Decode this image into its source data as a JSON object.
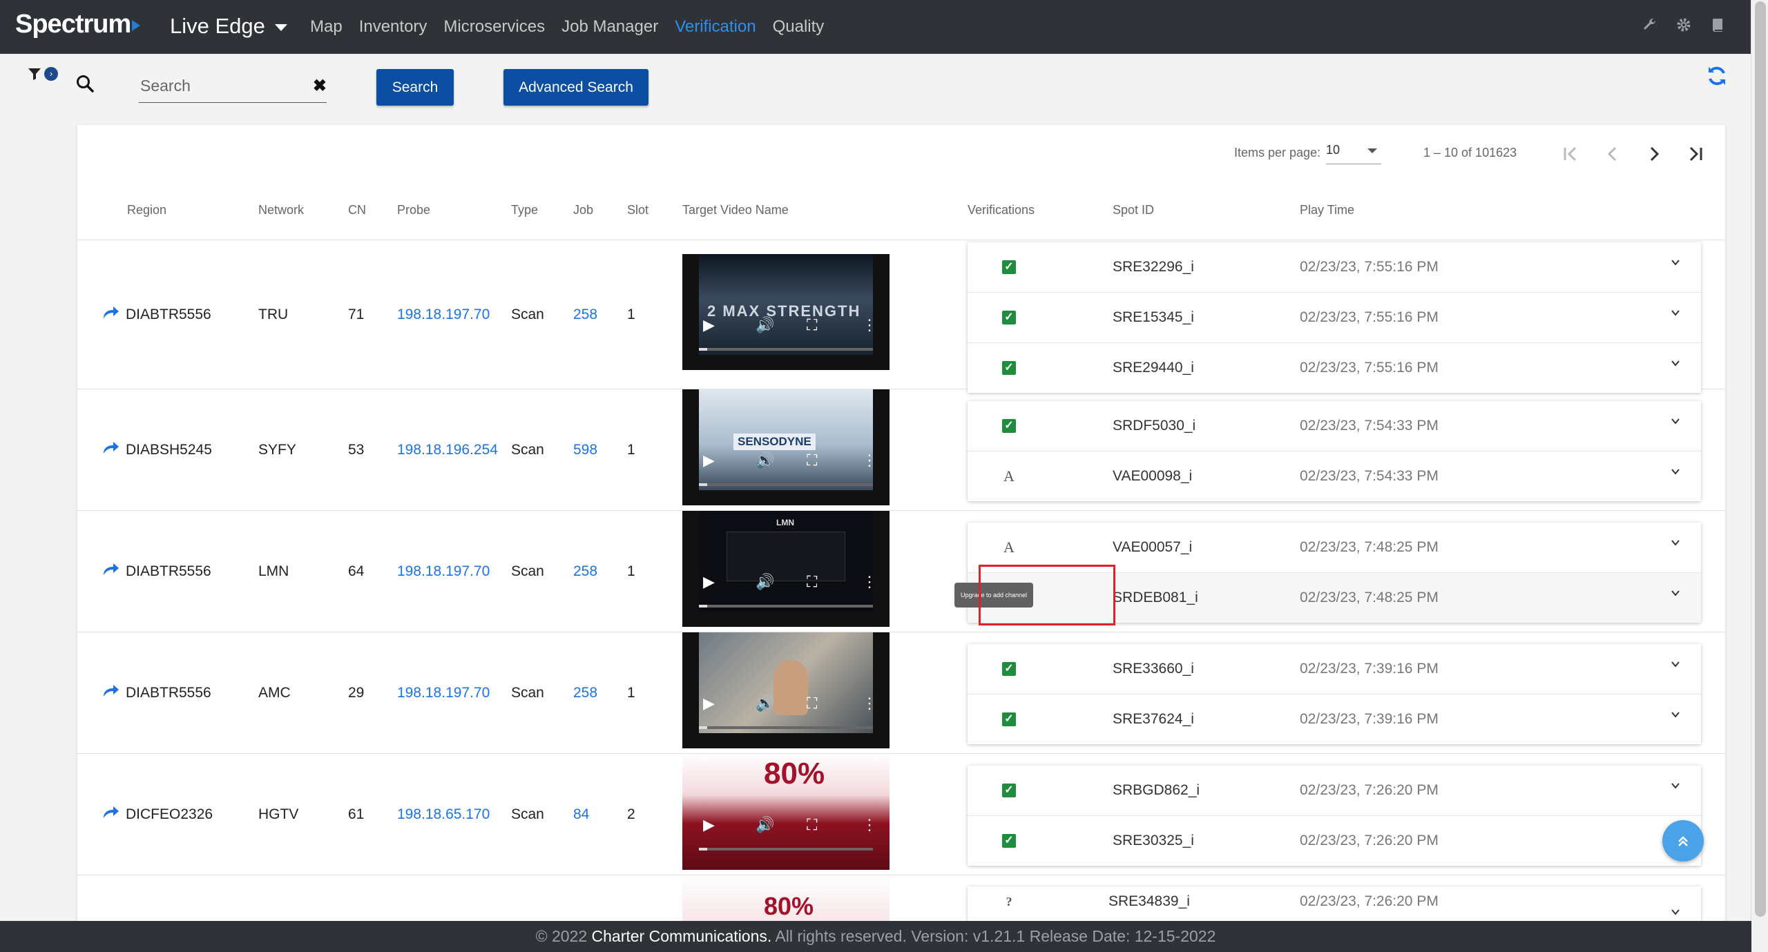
{
  "brand": "Spectrum",
  "product": "Live Edge",
  "nav": [
    "Map",
    "Inventory",
    "Microservices",
    "Job Manager",
    "Verification",
    "Quality"
  ],
  "nav_active": "Verification",
  "search": {
    "placeholder": "Search",
    "search_btn": "Search",
    "advanced_btn": "Advanced Search"
  },
  "paginator": {
    "items_label": "Items per page:",
    "items_value": "10",
    "range": "1 – 10 of 101623"
  },
  "columns": [
    "Region",
    "Network",
    "CN",
    "Probe",
    "Type",
    "Job",
    "Slot",
    "Target Video Name",
    "Verifications",
    "Spot ID",
    "Play Time"
  ],
  "rows": [
    {
      "region": "DIABTR5556",
      "network": "TRU",
      "cn": "71",
      "probe": "198.18.197.70",
      "type": "Scan",
      "job": "258",
      "slot": "1",
      "video_text": "2 MAX STRENGTH",
      "verifications": [
        {
          "status": "ok",
          "spot": "SRE32296_i",
          "time": "02/23/23, 7:55:16 PM"
        },
        {
          "status": "ok",
          "spot": "SRE15345_i",
          "time": "02/23/23, 7:55:16 PM"
        },
        {
          "status": "ok",
          "spot": "SRE29440_i",
          "time": "02/23/23, 7:55:16 PM"
        }
      ]
    },
    {
      "region": "DIABSH5245",
      "network": "SYFY",
      "cn": "53",
      "probe": "198.18.196.254",
      "type": "Scan",
      "job": "598",
      "slot": "1",
      "video_text": "SENSODYNE",
      "verifications": [
        {
          "status": "ok",
          "spot": "SRDF5030_i",
          "time": "02/23/23, 7:54:33 PM"
        },
        {
          "status": "text",
          "spot": "VAE00098_i",
          "time": "02/23/23, 7:54:33 PM"
        }
      ]
    },
    {
      "region": "DIABTR5556",
      "network": "LMN",
      "cn": "64",
      "probe": "198.18.197.70",
      "type": "Scan",
      "job": "258",
      "slot": "1",
      "video_text": "LMN",
      "verifications": [
        {
          "status": "text",
          "spot": "VAE00057_i",
          "time": "02/23/23, 7:48:25 PM"
        },
        {
          "status": "bad",
          "spot": "SRDEB081_i",
          "time": "02/23/23, 7:48:25 PM"
        }
      ]
    },
    {
      "region": "DIABTR5556",
      "network": "AMC",
      "cn": "29",
      "probe": "198.18.197.70",
      "type": "Scan",
      "job": "258",
      "slot": "1",
      "video_text": "",
      "verifications": [
        {
          "status": "ok",
          "spot": "SRE33660_i",
          "time": "02/23/23, 7:39:16 PM"
        },
        {
          "status": "ok",
          "spot": "SRE37624_i",
          "time": "02/23/23, 7:39:16 PM"
        }
      ]
    },
    {
      "region": "DICFEO2326",
      "network": "HGTV",
      "cn": "61",
      "probe": "198.18.65.170",
      "type": "Scan",
      "job": "84",
      "slot": "2",
      "video_text": "80%",
      "verifications": [
        {
          "status": "ok",
          "spot": "SRBGD862_i",
          "time": "02/23/23, 7:26:20 PM"
        },
        {
          "status": "ok",
          "spot": "SRE30325_i",
          "time": "02/23/23, 7:26:20 PM"
        }
      ]
    },
    {
      "region": "",
      "network": "",
      "cn": "",
      "probe": "",
      "type": "",
      "job": "",
      "slot": "",
      "video_text": "80%",
      "verifications": [
        {
          "status": "unknown",
          "spot": "SRE34839_i",
          "time": "02/23/23, 7:26:20 PM"
        }
      ]
    }
  ],
  "tooltip": "Upgrade to add channel",
  "footer": {
    "year": "2022",
    "company": "Charter Communications.",
    "rest": "All rights reserved. Version: v1.21.1 Release Date: 12-15-2022"
  }
}
